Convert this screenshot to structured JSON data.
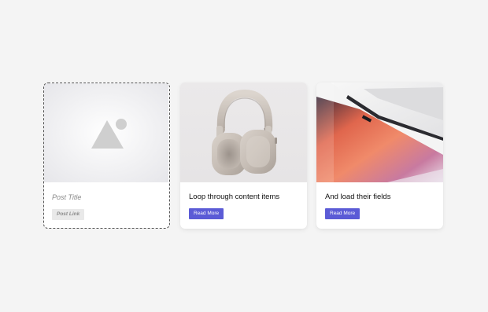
{
  "cards": [
    {
      "title": "Post Title",
      "button": "Post Link",
      "image": "placeholder-image-icon"
    },
    {
      "title": "Loop through content items",
      "button": "Read More",
      "image": "headphones-image"
    },
    {
      "title": "And load their fields",
      "button": "Read More",
      "image": "laptop-image"
    }
  ],
  "colors": {
    "background": "#f4f4f4",
    "button": "#5b5bd6",
    "placeholder_button": "#e9e9e9",
    "dashed_border": "#555555"
  }
}
